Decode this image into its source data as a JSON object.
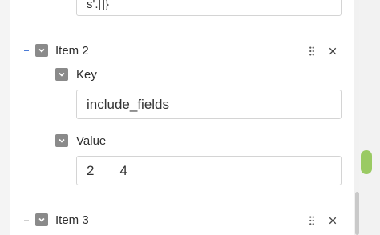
{
  "top_field": {
    "value": "s'.[]}"
  },
  "items": [
    {
      "title": "Item 2",
      "key_label": "Key",
      "key_value": "include_fields",
      "value_label": "Value",
      "value_prefix": "2",
      "value_suffix": "4"
    },
    {
      "title": "Item 3"
    }
  ],
  "icons": {
    "collapse": "chevron-down-icon",
    "drag": "drag-handle-icon",
    "remove": "close-icon"
  },
  "colors": {
    "guide_line": "#4b7bd6",
    "checkbox": "#8a8a8a"
  }
}
